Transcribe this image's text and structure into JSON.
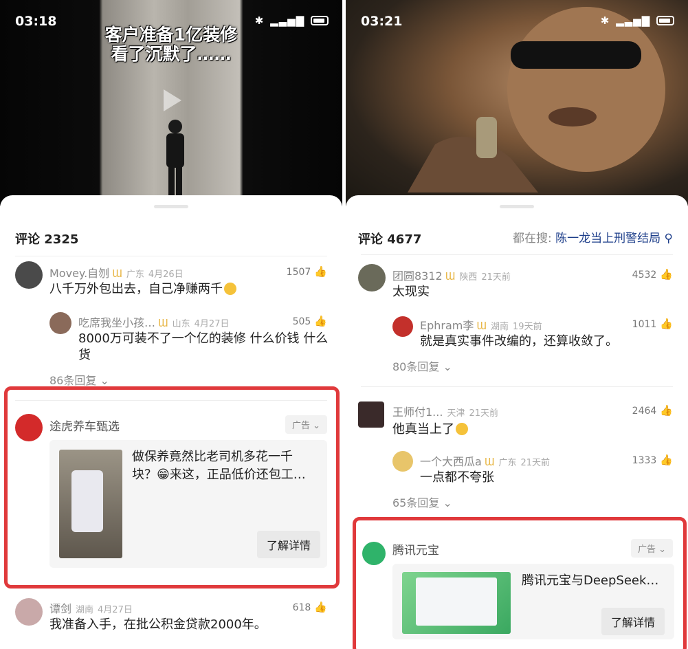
{
  "left": {
    "status": {
      "time": "03:18"
    },
    "video_title_line1": "客户准备1亿装修",
    "video_title_line2": "看了沉默了……",
    "comments_header": "评论 2325",
    "comments": [
      {
        "user": "Movey.自刎",
        "location": "广东",
        "date": "4月26日",
        "likes": "1507",
        "text": "八千万外包出去，自己净赚两千"
      },
      {
        "user": "吃席我坐小孩…",
        "location": "山东",
        "date": "4月27日",
        "likes": "505",
        "text_line1": "8000万可装不了一个亿的装修 什么价钱 什么",
        "text_line2": "货"
      }
    ],
    "replies_link": "86条回复",
    "ad": {
      "advertiser": "途虎养车甄选",
      "tag": "广告",
      "text_line1": "做保养竟然比老司机多花一千",
      "text_line2": "块？😁来这，正品低价还包工…",
      "button": "了解详情"
    },
    "comment3": {
      "user": "谭剑",
      "location": "湖南",
      "date": "4月27日",
      "likes": "618",
      "text": "我准备入手，在批公积金贷款2000年。"
    }
  },
  "right": {
    "status": {
      "time": "03:21"
    },
    "comments_header": "评论 4677",
    "search_prefix": "都在搜:",
    "search_term": "陈一龙当上刑警结局",
    "comments": [
      {
        "user": "团圆8312",
        "location": "陕西",
        "date": "21天前",
        "likes": "4532",
        "text": "太现实"
      },
      {
        "user": "Ephram李",
        "location": "湖南",
        "date": "19天前",
        "likes": "1011",
        "text": "就是真实事件改编的，还算收敛了。"
      }
    ],
    "replies_link_1": "80条回复",
    "comments2": [
      {
        "user": "王师付1...",
        "location": "天津",
        "date": "21天前",
        "likes": "2464",
        "text": "他真当上了"
      },
      {
        "user": "一个大西瓜a",
        "location": "广东",
        "date": "21天前",
        "likes": "1333",
        "text": "一点都不夸张"
      }
    ],
    "replies_link_2": "65条回复",
    "ad": {
      "advertiser": "腾讯元宝",
      "tag": "广告",
      "text": "腾讯元宝与DeepSeek…",
      "button": "了解详情"
    }
  },
  "colors": {
    "highlight": "#e0393b",
    "link_blue": "#1d3e8a"
  }
}
